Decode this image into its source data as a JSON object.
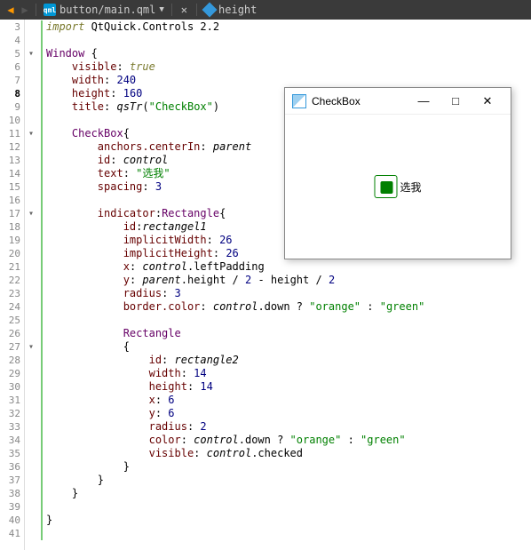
{
  "toolbar": {
    "file_path": "button/main.qml",
    "member": "height"
  },
  "gutter": {
    "start": 3,
    "end": 41,
    "current": 8,
    "fold_lines": [
      5,
      11,
      17,
      27
    ]
  },
  "code": {
    "lines": [
      {
        "n": 3,
        "tokens": [
          [
            "kw",
            "import"
          ],
          [
            "",
            " QtQuick.Controls 2.2"
          ]
        ]
      },
      {
        "n": 4,
        "tokens": []
      },
      {
        "n": 5,
        "tokens": [
          [
            "type",
            "Window"
          ],
          [
            "",
            " {"
          ]
        ]
      },
      {
        "n": 6,
        "tokens": [
          [
            "",
            "    "
          ],
          [
            "prop",
            "visible"
          ],
          [
            "",
            ": "
          ],
          [
            "kw ital",
            "true"
          ]
        ]
      },
      {
        "n": 7,
        "tokens": [
          [
            "",
            "    "
          ],
          [
            "prop",
            "width"
          ],
          [
            "",
            ": "
          ],
          [
            "num",
            "240"
          ]
        ]
      },
      {
        "n": 8,
        "tokens": [
          [
            "",
            "    "
          ],
          [
            "prop",
            "height"
          ],
          [
            "",
            ": "
          ],
          [
            "num",
            "160"
          ]
        ]
      },
      {
        "n": 9,
        "tokens": [
          [
            "",
            "    "
          ],
          [
            "prop",
            "title"
          ],
          [
            "",
            ": "
          ],
          [
            "func",
            "qsTr"
          ],
          [
            "",
            "("
          ],
          [
            "str",
            "\"CheckBox\""
          ],
          [
            "",
            ")"
          ]
        ]
      },
      {
        "n": 10,
        "tokens": []
      },
      {
        "n": 11,
        "tokens": [
          [
            "",
            "    "
          ],
          [
            "type",
            "CheckBox"
          ],
          [
            "",
            "{"
          ]
        ]
      },
      {
        "n": 12,
        "tokens": [
          [
            "",
            "        "
          ],
          [
            "prop",
            "anchors.centerIn"
          ],
          [
            "",
            ": "
          ],
          [
            "ital",
            "parent"
          ]
        ]
      },
      {
        "n": 13,
        "tokens": [
          [
            "",
            "        "
          ],
          [
            "prop",
            "id"
          ],
          [
            "",
            ": "
          ],
          [
            "ital",
            "control"
          ]
        ]
      },
      {
        "n": 14,
        "tokens": [
          [
            "",
            "        "
          ],
          [
            "prop",
            "text"
          ],
          [
            "",
            ": "
          ],
          [
            "str",
            "\"选我\""
          ]
        ]
      },
      {
        "n": 15,
        "tokens": [
          [
            "",
            "        "
          ],
          [
            "prop",
            "spacing"
          ],
          [
            "",
            ": "
          ],
          [
            "num",
            "3"
          ]
        ]
      },
      {
        "n": 16,
        "tokens": []
      },
      {
        "n": 17,
        "tokens": [
          [
            "",
            "        "
          ],
          [
            "prop",
            "indicator"
          ],
          [
            "",
            ":"
          ],
          [
            "type",
            "Rectangle"
          ],
          [
            "",
            "{"
          ]
        ]
      },
      {
        "n": 18,
        "tokens": [
          [
            "",
            "            "
          ],
          [
            "prop",
            "id"
          ],
          [
            "",
            ":"
          ],
          [
            "ital",
            "rectangel1"
          ]
        ]
      },
      {
        "n": 19,
        "tokens": [
          [
            "",
            "            "
          ],
          [
            "prop",
            "implicitWidth"
          ],
          [
            "",
            ": "
          ],
          [
            "num",
            "26"
          ]
        ]
      },
      {
        "n": 20,
        "tokens": [
          [
            "",
            "            "
          ],
          [
            "prop",
            "implicitHeight"
          ],
          [
            "",
            ": "
          ],
          [
            "num",
            "26"
          ]
        ]
      },
      {
        "n": 21,
        "tokens": [
          [
            "",
            "            "
          ],
          [
            "prop",
            "x"
          ],
          [
            "",
            ": "
          ],
          [
            "ital",
            "control"
          ],
          [
            "",
            ".leftPadding"
          ]
        ]
      },
      {
        "n": 22,
        "tokens": [
          [
            "",
            "            "
          ],
          [
            "prop",
            "y"
          ],
          [
            "",
            ": "
          ],
          [
            "ital",
            "parent"
          ],
          [
            "",
            ".height / "
          ],
          [
            "num",
            "2"
          ],
          [
            "",
            " - height / "
          ],
          [
            "num",
            "2"
          ]
        ]
      },
      {
        "n": 23,
        "tokens": [
          [
            "",
            "            "
          ],
          [
            "prop",
            "radius"
          ],
          [
            "",
            ": "
          ],
          [
            "num",
            "3"
          ]
        ]
      },
      {
        "n": 24,
        "tokens": [
          [
            "",
            "            "
          ],
          [
            "prop",
            "border.color"
          ],
          [
            "",
            ": "
          ],
          [
            "ital",
            "control"
          ],
          [
            "",
            ".down ? "
          ],
          [
            "str",
            "\"orange\""
          ],
          [
            "",
            " : "
          ],
          [
            "str",
            "\"green\""
          ]
        ]
      },
      {
        "n": 25,
        "tokens": []
      },
      {
        "n": 26,
        "tokens": [
          [
            "",
            "            "
          ],
          [
            "type",
            "Rectangle"
          ]
        ]
      },
      {
        "n": 27,
        "tokens": [
          [
            "",
            "            {"
          ]
        ]
      },
      {
        "n": 28,
        "tokens": [
          [
            "",
            "                "
          ],
          [
            "prop",
            "id"
          ],
          [
            "",
            ": "
          ],
          [
            "ital",
            "rectangle2"
          ]
        ]
      },
      {
        "n": 29,
        "tokens": [
          [
            "",
            "                "
          ],
          [
            "prop",
            "width"
          ],
          [
            "",
            ": "
          ],
          [
            "num",
            "14"
          ]
        ]
      },
      {
        "n": 30,
        "tokens": [
          [
            "",
            "                "
          ],
          [
            "prop",
            "height"
          ],
          [
            "",
            ": "
          ],
          [
            "num",
            "14"
          ]
        ]
      },
      {
        "n": 31,
        "tokens": [
          [
            "",
            "                "
          ],
          [
            "prop",
            "x"
          ],
          [
            "",
            ": "
          ],
          [
            "num",
            "6"
          ]
        ]
      },
      {
        "n": 32,
        "tokens": [
          [
            "",
            "                "
          ],
          [
            "prop",
            "y"
          ],
          [
            "",
            ": "
          ],
          [
            "num",
            "6"
          ]
        ]
      },
      {
        "n": 33,
        "tokens": [
          [
            "",
            "                "
          ],
          [
            "prop",
            "radius"
          ],
          [
            "",
            ": "
          ],
          [
            "num",
            "2"
          ]
        ]
      },
      {
        "n": 34,
        "tokens": [
          [
            "",
            "                "
          ],
          [
            "prop",
            "color"
          ],
          [
            "",
            ": "
          ],
          [
            "ital",
            "control"
          ],
          [
            "",
            ".down ? "
          ],
          [
            "str",
            "\"orange\""
          ],
          [
            "",
            " : "
          ],
          [
            "str",
            "\"green\""
          ]
        ]
      },
      {
        "n": 35,
        "tokens": [
          [
            "",
            "                "
          ],
          [
            "prop",
            "visible"
          ],
          [
            "",
            ": "
          ],
          [
            "ital",
            "control"
          ],
          [
            "",
            ".checked"
          ]
        ]
      },
      {
        "n": 36,
        "tokens": [
          [
            "",
            "            }"
          ]
        ]
      },
      {
        "n": 37,
        "tokens": [
          [
            "",
            "        }"
          ]
        ]
      },
      {
        "n": 38,
        "tokens": [
          [
            "",
            "    }"
          ]
        ]
      },
      {
        "n": 39,
        "tokens": []
      },
      {
        "n": 40,
        "tokens": [
          [
            "",
            "}"
          ]
        ]
      },
      {
        "n": 41,
        "tokens": []
      }
    ]
  },
  "app_window": {
    "title": "CheckBox",
    "checkbox_label": "选我",
    "checked": true,
    "indicator_border": "#008000",
    "indicator_fill": "#008000"
  }
}
